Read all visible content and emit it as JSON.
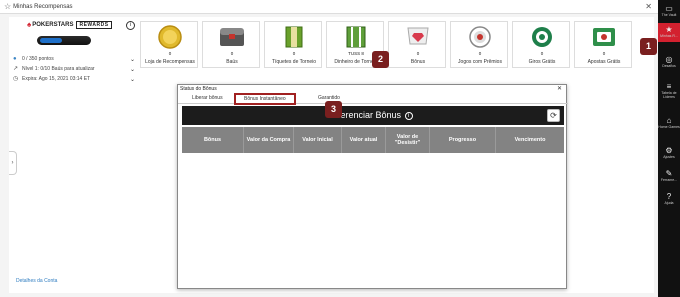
{
  "window": {
    "title": "Minhas Recompensas",
    "close": "✕"
  },
  "left_panel": {
    "brand": "POKERSTARS",
    "rewards_tag": "REWARDS",
    "info": "i",
    "points_text": "0 / 350 pontos",
    "level_text": "Nível 1: 0/10 Baús para atualizar",
    "expire_text": "Expira: Ago 15, 2021 03:14 ET",
    "account_link": "Detalhes da Conta",
    "chevron": "⌄",
    "expand_arrow": "›"
  },
  "cards": [
    {
      "count": "0",
      "label": "Loja de Recompensas",
      "icon": "coin-icon"
    },
    {
      "count": "0",
      "label": "Baús",
      "icon": "chest-icon"
    },
    {
      "count": "0",
      "label": "Tíquetes de Torneio",
      "icon": "ticket-icon"
    },
    {
      "count": "TUSS 8",
      "label": "Dinheiro de Torneio",
      "icon": "cash-icon"
    },
    {
      "count": "0",
      "label": "Bônus",
      "icon": "diamond-icon"
    },
    {
      "count": "0",
      "label": "Jogos com Prêmios",
      "icon": "prize-game-icon"
    },
    {
      "count": "0",
      "label": "Giros Grátis",
      "icon": "free-spin-icon"
    },
    {
      "count": "0",
      "label": "Apostas Grátis",
      "icon": "free-bet-icon"
    }
  ],
  "sidebar": [
    {
      "glyph": "▭",
      "label": "The Vault"
    },
    {
      "glyph": "★",
      "label": "Minhas R..."
    },
    {
      "glyph": "◎",
      "label": "Desafios"
    },
    {
      "glyph": "≡",
      "label": "Tabela de Líderes"
    },
    {
      "glyph": "⌂",
      "label": "Home Games"
    },
    {
      "glyph": "⚙",
      "label": "Ajustes"
    },
    {
      "glyph": "✎",
      "label": "Ferrame..."
    },
    {
      "glyph": "?",
      "label": "Ajuda"
    }
  ],
  "annotations": [
    "1",
    "2",
    "3"
  ],
  "dialog": {
    "title": "Status do Bônus",
    "close": "✕",
    "tabs": [
      "Liberar bônus",
      "Bônus Instantâneo",
      "Garantido"
    ],
    "heading": "Gerenciar Bônus",
    "info": "i",
    "refresh": "⟳",
    "columns": [
      "Bônus",
      "Valor da Compra",
      "Valor Inicial",
      "Valor atual",
      "Valor de \"Desistir\"",
      "Progresso",
      "Vencimento"
    ]
  },
  "colors": {
    "brand_red": "#d3212f",
    "annotation": "#7a1f1f",
    "table_header": "#838383"
  }
}
